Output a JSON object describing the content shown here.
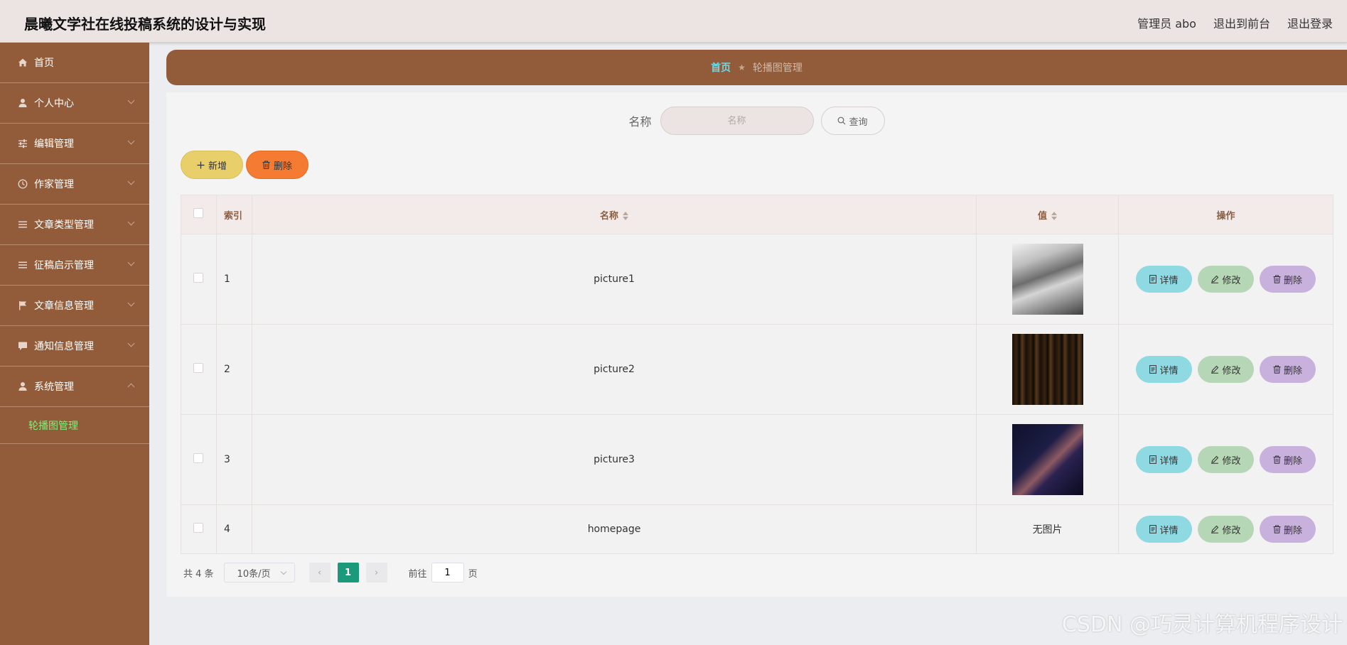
{
  "header": {
    "title": "晨曦文学社在线投稿系统的设计与实现",
    "admin_label": "管理员 abo",
    "to_front": "退出到前台",
    "logout": "退出登录"
  },
  "sidebar": {
    "items": [
      {
        "label": "首页",
        "icon": "home-icon"
      },
      {
        "label": "个人中心",
        "icon": "user-icon"
      },
      {
        "label": "编辑管理",
        "icon": "sliders-icon"
      },
      {
        "label": "作家管理",
        "icon": "clock-icon"
      },
      {
        "label": "文章类型管理",
        "icon": "list-icon"
      },
      {
        "label": "征稿启示管理",
        "icon": "list-icon"
      },
      {
        "label": "文章信息管理",
        "icon": "flag-icon"
      },
      {
        "label": "通知信息管理",
        "icon": "message-icon"
      },
      {
        "label": "系统管理",
        "icon": "user-icon"
      }
    ],
    "submenu": {
      "label": "轮播图管理"
    }
  },
  "breadcrumb": {
    "home": "首页",
    "current": "轮播图管理"
  },
  "search": {
    "label": "名称",
    "placeholder": "名称",
    "button": "查询"
  },
  "actions": {
    "add": "新增",
    "delete": "删除"
  },
  "table": {
    "headers": {
      "index": "索引",
      "name": "名称",
      "value": "值",
      "ops": "操作"
    },
    "rows": [
      {
        "index": "1",
        "name": "picture1",
        "value": "",
        "has_image": true
      },
      {
        "index": "2",
        "name": "picture2",
        "value": "",
        "has_image": true
      },
      {
        "index": "3",
        "name": "picture3",
        "value": "",
        "has_image": true
      },
      {
        "index": "4",
        "name": "homepage",
        "value": "无图片",
        "has_image": false
      }
    ],
    "op_labels": {
      "detail": "详情",
      "edit": "修改",
      "delete": "删除"
    }
  },
  "pager": {
    "total": "共 4 条",
    "page_size": "10条/页",
    "current_page": "1",
    "goto_prefix": "前往",
    "goto_value": "1",
    "goto_suffix": "页"
  },
  "watermark": "CSDN @巧灵计算机程序设计"
}
